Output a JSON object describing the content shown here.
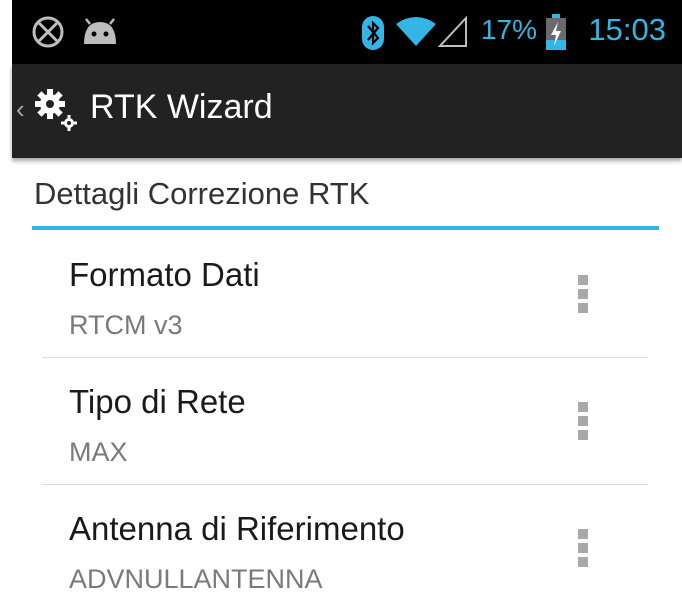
{
  "status_bar": {
    "left_icons": [
      "gps-off-icon",
      "android-debug-icon"
    ],
    "right_icons": [
      "bluetooth-icon",
      "wifi-icon",
      "cell-signal-icon",
      "battery-charging-icon"
    ],
    "battery_percent": "17%",
    "time": "15:03",
    "accent": "#33b5e5"
  },
  "action_bar": {
    "title": "RTK Wizard",
    "icon": "gear-icon"
  },
  "section": {
    "title": "Dettagli Correzione RTK"
  },
  "preferences": [
    {
      "title": "Formato Dati",
      "summary": "RTCM v3"
    },
    {
      "title": "Tipo di Rete",
      "summary": "MAX"
    },
    {
      "title": "Antenna di Riferimento",
      "summary": "ADVNULLANTENNA"
    }
  ]
}
